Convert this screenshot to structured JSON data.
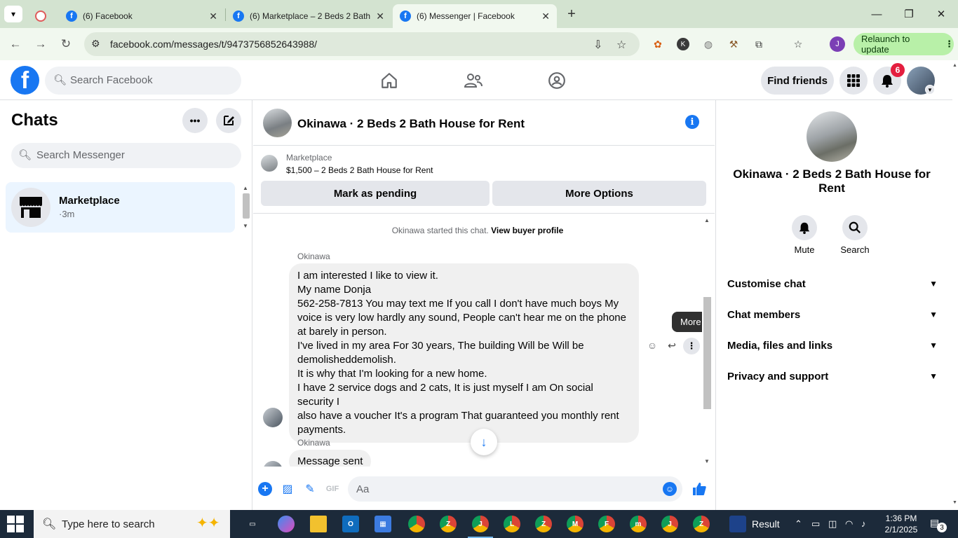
{
  "browser": {
    "tabs": [
      {
        "title": "(6) Facebook",
        "active": false
      },
      {
        "title": "(6) Marketplace – 2 Beds 2 Bath",
        "active": false
      },
      {
        "title": "(6) Messenger | Facebook",
        "active": true
      }
    ],
    "url": "facebook.com/messages/t/9473756852643988/",
    "relaunch_label": "Relaunch to update",
    "profile_initial": "J"
  },
  "fb": {
    "search_placeholder": "Search Facebook",
    "find_friends": "Find friends",
    "notification_count": "6",
    "brand_color": "#1877f2"
  },
  "chats": {
    "title": "Chats",
    "search_placeholder": "Search Messenger",
    "items": [
      {
        "name": "Marketplace",
        "meta": "·3m"
      }
    ]
  },
  "conversation": {
    "title": "Okinawa · 2 Beds 2 Bath House for Rent",
    "marketplace": {
      "label": "Marketplace",
      "listing": "$1,500 – 2 Beds 2 Bath House for Rent",
      "btn_pending": "Mark as pending",
      "btn_more": "More Options"
    },
    "system_text": "Okinawa started this chat.",
    "system_link": "View buyer profile",
    "messages": [
      {
        "sender": "Okinawa",
        "lines": [
          "I am interested I like to view it.",
          "My name Donja",
          "562-258-7813 You may text me If you call I don't have much boys My",
          "voice is very low hardly any sound, People can't hear me on the phone",
          "at barely in person.",
          "I've lived in my area For 30 years, The building  Will be Will be",
          "demolisheddemolish.",
          "It is why that I'm looking for a new home.",
          "I have 2 service dogs and 2 cats, It is just myself I am On social security I",
          "also have a voucher It's a program That guaranteed you monthly rent",
          "payments."
        ]
      },
      {
        "sender": "Okinawa",
        "text": "Message sent"
      }
    ],
    "tooltip": "More",
    "composer_placeholder": "Aa"
  },
  "details": {
    "name": "Okinawa · 2 Beds 2 Bath House for Rent",
    "actions": [
      {
        "label": "Mute",
        "icon": "bell-icon"
      },
      {
        "label": "Search",
        "icon": "search-icon"
      }
    ],
    "sections": [
      "Customise chat",
      "Chat members",
      "Media, files and links",
      "Privacy and support"
    ]
  },
  "taskbar": {
    "search_placeholder": "Type here to search",
    "weather_label": "Result",
    "time": "1:36 PM",
    "date": "2/1/2025",
    "notification_count": "3"
  }
}
